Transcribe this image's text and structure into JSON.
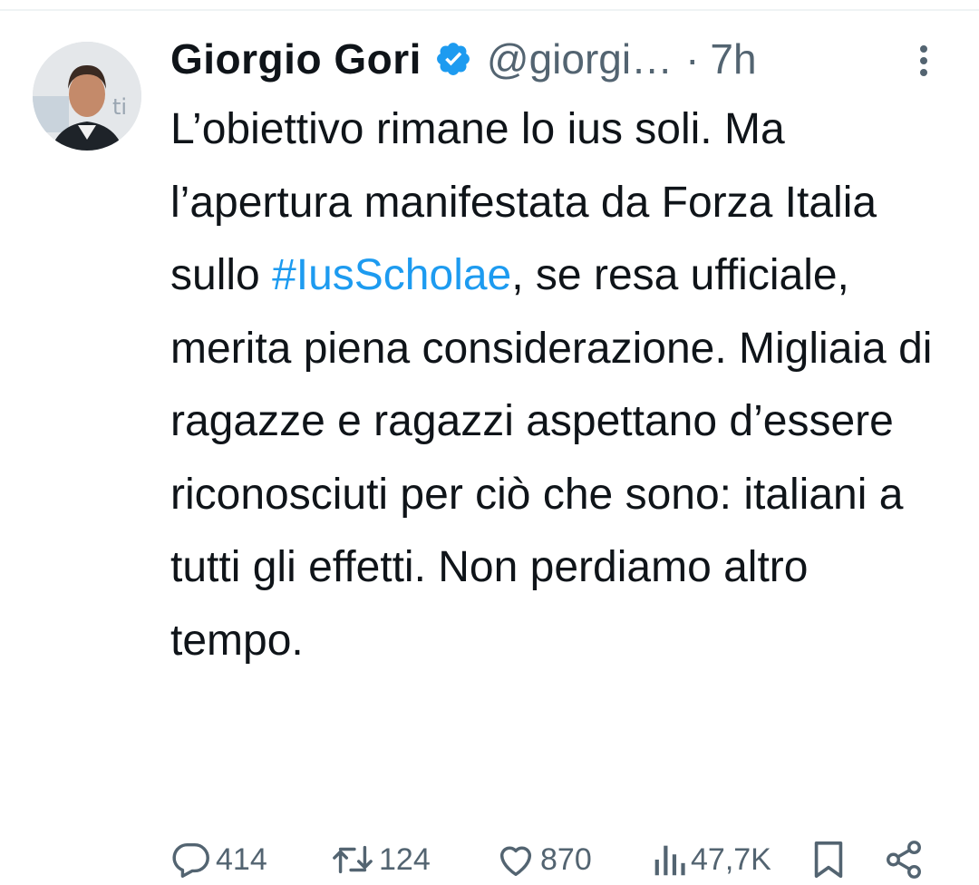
{
  "tweet": {
    "author_name": "Giorgio Gori",
    "handle": "@giorgi…",
    "separator": "·",
    "time": "7h",
    "text_before": "L’obiettivo rimane lo ius soli. Ma l’apertura manifestata da Forza Italia sullo ",
    "hashtag": "#IusScholae",
    "text_after": ", se resa ufficiale, merita piena considerazione. Migliaia di ragazze e ragazzi aspettano d’essere riconosciuti per ciò che sono: italiani a tutti gli effetti. Non perdiamo altro tempo."
  },
  "actions": {
    "replies": "414",
    "reposts": "124",
    "likes": "870",
    "views": "47,7K"
  },
  "icons": {
    "verified": "verified-badge-icon",
    "more": "more-vertical-icon",
    "reply": "reply-icon",
    "repost": "repost-icon",
    "like": "heart-icon",
    "views": "views-icon",
    "bookmark": "bookmark-icon",
    "share": "share-icon"
  },
  "colors": {
    "text": "#0f1419",
    "secondary": "#536471",
    "link": "#1d9bf0",
    "verified": "#1d9bf0"
  }
}
